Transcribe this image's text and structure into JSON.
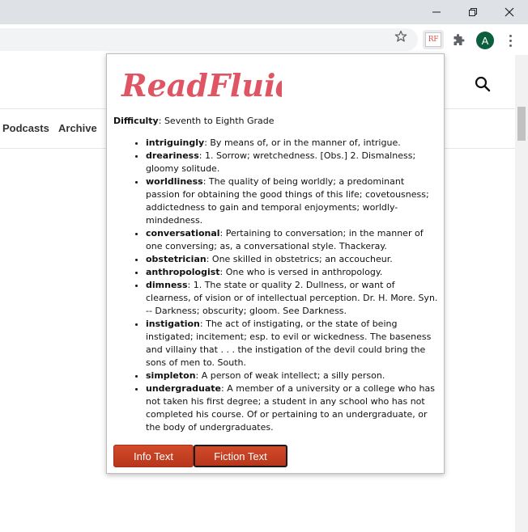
{
  "browser": {
    "window_controls": [
      "minimize",
      "restore",
      "close"
    ],
    "extension_badge": "RF",
    "profile_initial": "A",
    "accent_avatar": "#0b5f3c"
  },
  "page": {
    "nav": [
      "Podcasts",
      "Archive"
    ]
  },
  "popup": {
    "logo_text": "ReadFluid",
    "logo_color": "#e05563",
    "difficulty_label": "Difficulty",
    "difficulty_value": "Seventh to Eighth Grade",
    "words": [
      {
        "term": "intriguingly",
        "definition": "By means of, or in the manner of, intrigue."
      },
      {
        "term": "dreariness",
        "definition": "1. Sorrow; wretchedness. [Obs.] 2. Dismalness; gloomy solitude."
      },
      {
        "term": "worldliness",
        "definition": "The quality of being worldly; a predominant passion for obtaining the good things of this life; covetousness; addictedness to gain and temporal enjoyments; worldly-mindedness."
      },
      {
        "term": "conversational",
        "definition": "Pertaining to conversation; in the manner of one conversing; as, a conversational style. Thackeray."
      },
      {
        "term": "obstetrician",
        "definition": "One skilled in obstetrics; an accoucheur."
      },
      {
        "term": "anthropologist",
        "definition": "One who is versed in anthropology."
      },
      {
        "term": "dimness",
        "definition": "1. The state or quality 2. Dullness, or want of clearness, of vision or of intellectual perception. Dr. H. More. Syn. -- Darkness; obscurity; gloom. See Darkness."
      },
      {
        "term": "instigation",
        "definition": "The act of instigating, or the state of being instigated; incitement; esp. to evil or wickedness. The baseness and villainy that . . . the instigation of the devil could bring the sons of men to. South."
      },
      {
        "term": "simpleton",
        "definition": "A person of weak intellect; a silly person."
      },
      {
        "term": "undergraduate",
        "definition": "A member of a university or a college who has not taken his first degree; a student in any school who has not completed his course. Of or pertaining to an undergraduate, or the body of undergraduates."
      }
    ],
    "buttons": {
      "info": "Info Text",
      "fiction": "Fiction Text"
    }
  }
}
